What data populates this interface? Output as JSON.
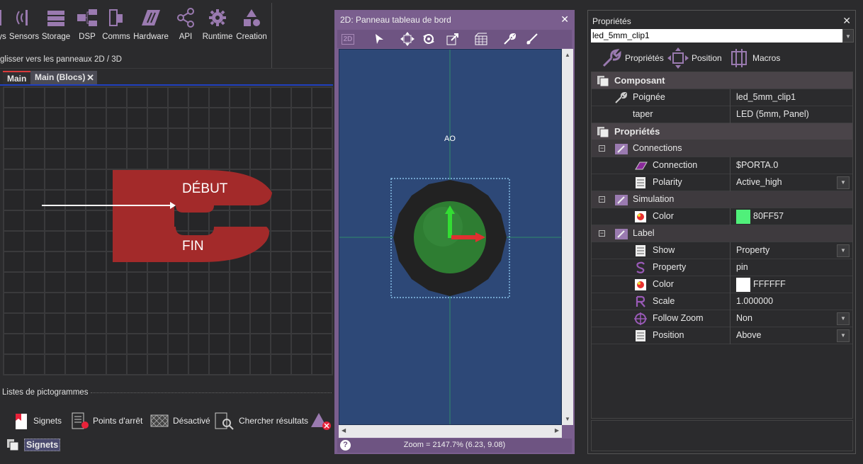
{
  "ribbon": {
    "buttons": [
      {
        "label": "ys",
        "icon": "bars-icon"
      },
      {
        "label": "Sensors",
        "icon": "sensor-wave-icon"
      },
      {
        "label": "Storage",
        "icon": "storage-icon"
      },
      {
        "label": "DSP",
        "icon": "dsp-flow-icon"
      },
      {
        "label": "Comms",
        "icon": "comms-icon"
      },
      {
        "label": "Hardware",
        "icon": "hardware-icon"
      },
      {
        "label": "API",
        "icon": "api-network-icon"
      },
      {
        "label": "Runtime",
        "icon": "gear-icon"
      },
      {
        "label": "Creation",
        "icon": "shapes-icon"
      }
    ],
    "hint": "glisser vers les panneaux 2D / 3D"
  },
  "tabs": {
    "main": "Main",
    "blocs": "Main (Blocs)",
    "close": "✕"
  },
  "flowchart": {
    "start_label": "DÉBUT",
    "end_label": "FIN"
  },
  "pictograms": {
    "header": "Listes de pictogrammes",
    "items": [
      {
        "label": "Signets",
        "icon": "bookmark-icon"
      },
      {
        "label": "Points d'arrêt",
        "icon": "breakpoint-icon"
      },
      {
        "label": "Désactivé",
        "icon": "disabled-pattern-icon"
      },
      {
        "label": "Chercher résultats",
        "icon": "search-results-icon"
      }
    ],
    "active_tab": "Signets"
  },
  "panel2d": {
    "title": "2D: Panneau tableau de bord",
    "close": "✕",
    "toolbar_2d_label": "2D",
    "component_label": "AO",
    "status": "Zoom = 2147.7% (6.23, 9.08)",
    "help": "?",
    "colors": {
      "background": "#2d4877",
      "led_fill": "#2e7d32",
      "bezel": "#222222"
    }
  },
  "properties": {
    "title": "Propriétés",
    "close": "✕",
    "selected_object": "led_5mm_clip1",
    "tabs": [
      {
        "label": "Propriétés",
        "icon": "wrench-icon"
      },
      {
        "label": "Position",
        "icon": "move-arrows-icon"
      },
      {
        "label": "Macros",
        "icon": "macro-icon"
      }
    ],
    "sections": {
      "composant": "Composant",
      "proprietes": "Propriétés",
      "connections": "Connections",
      "simulation": "Simulation",
      "label": "Label"
    },
    "rows": {
      "poignee": {
        "name": "Poignée",
        "value": "led_5mm_clip1"
      },
      "taper": {
        "name": "taper",
        "value": "LED (5mm, Panel)"
      },
      "connection": {
        "name": "Connection",
        "value": "$PORTA.0"
      },
      "polarity": {
        "name": "Polarity",
        "value": "Active_high"
      },
      "sim_color": {
        "name": "Color",
        "value": "80FF57",
        "swatch": "#50f07a"
      },
      "show": {
        "name": "Show",
        "value": "Property"
      },
      "property": {
        "name": "Property",
        "value": "pin"
      },
      "label_color": {
        "name": "Color",
        "value": "FFFFFF",
        "swatch": "#ffffff"
      },
      "scale": {
        "name": "Scale",
        "value": "1.000000"
      },
      "follow_zoom": {
        "name": "Follow Zoom",
        "value": "Non"
      },
      "position": {
        "name": "Position",
        "value": "Above"
      }
    },
    "accent": "#8a5aa8"
  }
}
